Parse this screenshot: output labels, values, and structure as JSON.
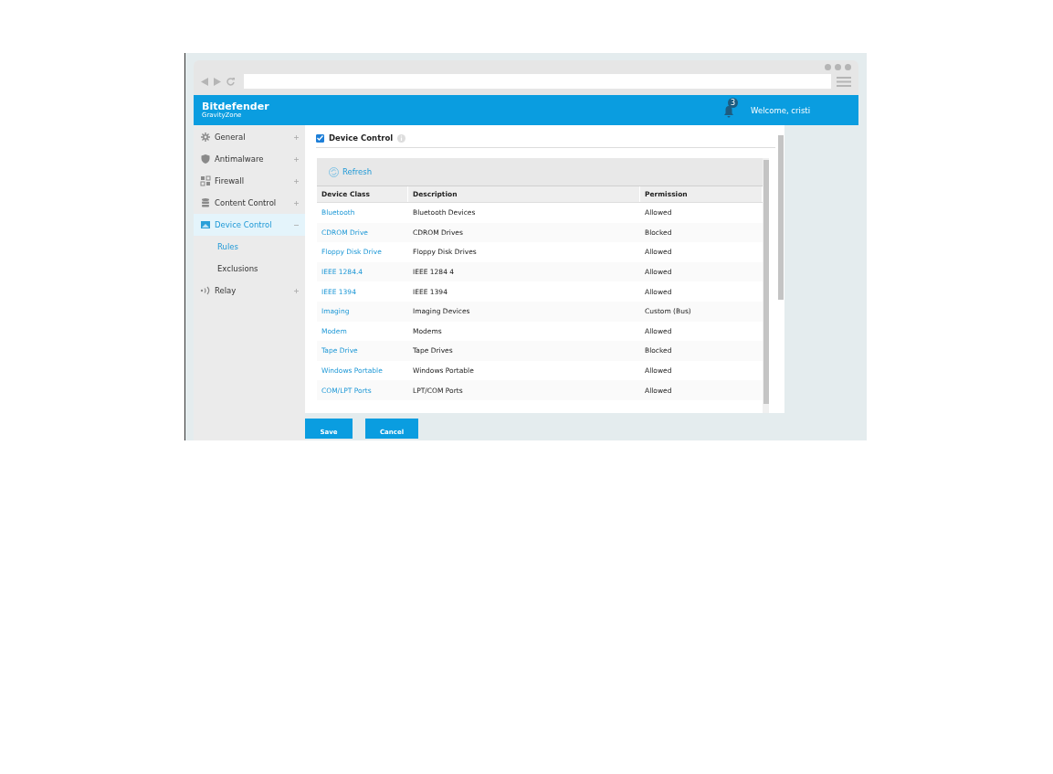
{
  "header": {
    "brand": "Bitdefender",
    "product": "GravityZone",
    "notifications": "3",
    "welcome": "Welcome, cristi"
  },
  "sidebar": {
    "items": [
      {
        "label": "General",
        "selected": false,
        "expanded": false
      },
      {
        "label": "Antimalware",
        "selected": false,
        "expanded": false
      },
      {
        "label": "Firewall",
        "selected": false,
        "expanded": false
      },
      {
        "label": "Content Control",
        "selected": false,
        "expanded": false
      },
      {
        "label": "Device Control",
        "selected": true,
        "expanded": true,
        "children": [
          {
            "label": "Rules",
            "selected": true
          },
          {
            "label": "Exclusions",
            "selected": false
          }
        ]
      },
      {
        "label": "Relay",
        "selected": false,
        "expanded": false
      }
    ]
  },
  "section": {
    "title": "Device Control",
    "checked": true
  },
  "toolbar": {
    "refresh": "Refresh"
  },
  "table": {
    "columns": [
      "Device Class",
      "Description",
      "Permission"
    ],
    "rows": [
      {
        "device_class": "Bluetooth",
        "description": "Bluetooth Devices",
        "permission": "Allowed"
      },
      {
        "device_class": "CDROM Drive",
        "description": "CDROM Drives",
        "permission": "Blocked"
      },
      {
        "device_class": "Floppy Disk Drive",
        "description": "Floppy Disk Drives",
        "permission": "Allowed"
      },
      {
        "device_class": "IEEE 1284.4",
        "description": "IEEE 1284 4",
        "permission": "Allowed"
      },
      {
        "device_class": "IEEE 1394",
        "description": "IEEE 1394",
        "permission": "Allowed"
      },
      {
        "device_class": "Imaging",
        "description": "Imaging Devices",
        "permission": "Custom (Bus)"
      },
      {
        "device_class": "Modem",
        "description": "Modems",
        "permission": "Allowed"
      },
      {
        "device_class": "Tape Drive",
        "description": "Tape Drives",
        "permission": "Blocked"
      },
      {
        "device_class": "Windows Portable",
        "description": "Windows Portable",
        "permission": "Allowed"
      },
      {
        "device_class": "COM/LPT Ports",
        "description": "LPT/COM Ports",
        "permission": "Allowed"
      }
    ]
  },
  "buttons": [
    "Save",
    "Cancel"
  ]
}
